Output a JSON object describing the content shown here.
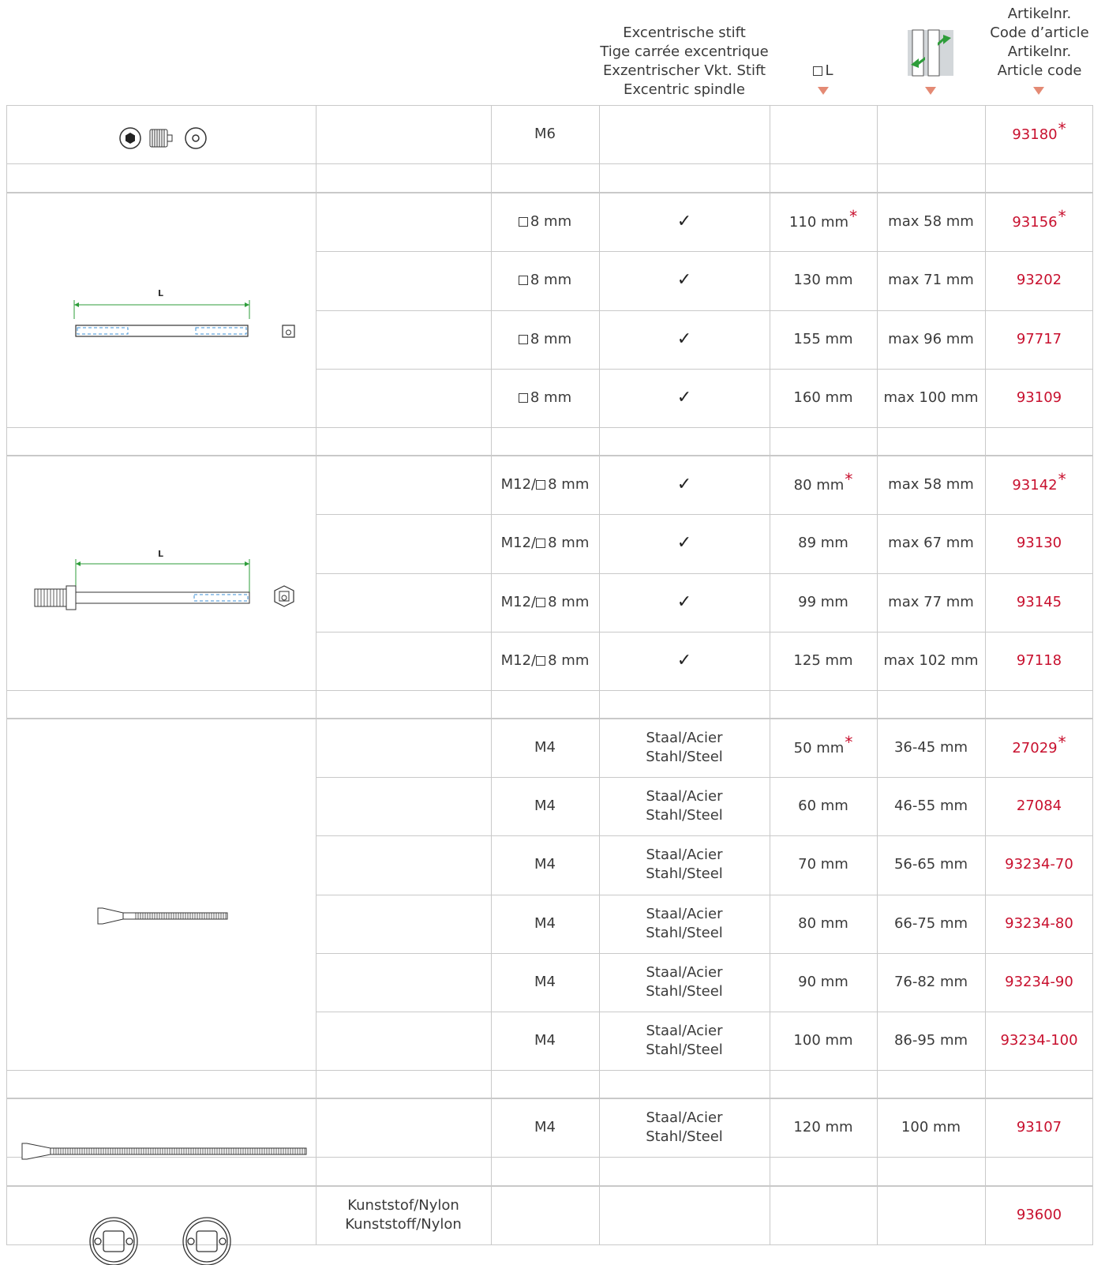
{
  "header": {
    "spindle_lines": [
      "Excentrische stift",
      "Tige carrée excentrique",
      "Exzentrischer Vkt. Stift",
      "Excentric spindle"
    ],
    "length_label": "L",
    "article_lines": [
      "Artikelnr.",
      "Code d’article",
      "Artikelnr.",
      "Article code"
    ],
    "door_thickness_icon": "door-thickness-icon",
    "accent_color": "#c8102e",
    "arrow_color": "#e48a74"
  },
  "groups": [
    {
      "image": "set-screw-icons",
      "rows": [
        {
          "material": "",
          "size": "M6",
          "spindle": "",
          "length": "",
          "length_star": false,
          "thickness": "",
          "code": "93180",
          "code_star": true
        }
      ]
    },
    {
      "image": "square-spindle-drawing",
      "image_label": "L",
      "rows": [
        {
          "material": "",
          "size": "8 mm",
          "size_prefix": "",
          "size_square": true,
          "spindle": "✓",
          "length": "110 mm",
          "length_star": true,
          "thickness": "max 58 mm",
          "code": "93156",
          "code_star": true
        },
        {
          "material": "",
          "size": "8 mm",
          "size_prefix": "",
          "size_square": true,
          "spindle": "✓",
          "length": "130 mm",
          "length_star": false,
          "thickness": "max 71 mm",
          "code": "93202",
          "code_star": false
        },
        {
          "material": "",
          "size": "8 mm",
          "size_prefix": "",
          "size_square": true,
          "spindle": "✓",
          "length": "155 mm",
          "length_star": false,
          "thickness": "max 96 mm",
          "code": "97717",
          "code_star": false
        },
        {
          "material": "",
          "size": "8 mm",
          "size_prefix": "",
          "size_square": true,
          "spindle": "✓",
          "length": "160 mm",
          "length_star": false,
          "thickness": "max 100 mm",
          "code": "93109",
          "code_star": false
        }
      ]
    },
    {
      "image": "threaded-spindle-drawing",
      "image_label": "L",
      "rows": [
        {
          "material": "",
          "size": "8 mm",
          "size_prefix": "M12/",
          "size_square": true,
          "spindle": "✓",
          "length": "80 mm",
          "length_star": true,
          "thickness": "max 58 mm",
          "code": "93142",
          "code_star": true
        },
        {
          "material": "",
          "size": "8 mm",
          "size_prefix": "M12/",
          "size_square": true,
          "spindle": "✓",
          "length": "89 mm",
          "length_star": false,
          "thickness": "max 67 mm",
          "code": "93130",
          "code_star": false
        },
        {
          "material": "",
          "size": "8 mm",
          "size_prefix": "M12/",
          "size_square": true,
          "spindle": "✓",
          "length": "99 mm",
          "length_star": false,
          "thickness": "max 77 mm",
          "code": "93145",
          "code_star": false
        },
        {
          "material": "",
          "size": "8 mm",
          "size_prefix": "M12/",
          "size_square": true,
          "spindle": "✓",
          "length": "125 mm",
          "length_star": false,
          "thickness": "max 102 mm",
          "code": "97118",
          "code_star": false
        }
      ]
    },
    {
      "image": "countersunk-screw-drawing",
      "rows": [
        {
          "material": "",
          "size": "M4",
          "spindle_lines": [
            "Staal/Acier",
            "Stahl/Steel"
          ],
          "length": "50 mm",
          "length_star": true,
          "thickness": "36-45 mm",
          "code": "27029",
          "code_star": true
        },
        {
          "material": "",
          "size": "M4",
          "spindle_lines": [
            "Staal/Acier",
            "Stahl/Steel"
          ],
          "length": "60 mm",
          "length_star": false,
          "thickness": "46-55 mm",
          "code": "27084",
          "code_star": false
        },
        {
          "material": "",
          "size": "M4",
          "spindle_lines": [
            "Staal/Acier",
            "Stahl/Steel"
          ],
          "length": "70 mm",
          "length_star": false,
          "thickness": "56-65 mm",
          "code": "93234-70",
          "code_star": false
        },
        {
          "material": "",
          "size": "M4",
          "spindle_lines": [
            "Staal/Acier",
            "Stahl/Steel"
          ],
          "length": "80 mm",
          "length_star": false,
          "thickness": "66-75 mm",
          "code": "93234-80",
          "code_star": false
        },
        {
          "material": "",
          "size": "M4",
          "spindle_lines": [
            "Staal/Acier",
            "Stahl/Steel"
          ],
          "length": "90 mm",
          "length_star": false,
          "thickness": "76-82 mm",
          "code": "93234-90",
          "code_star": false
        },
        {
          "material": "",
          "size": "M4",
          "spindle_lines": [
            "Staal/Acier",
            "Stahl/Steel"
          ],
          "length": "100 mm",
          "length_star": false,
          "thickness": "86-95 mm",
          "code": "93234-100",
          "code_star": false
        }
      ]
    },
    {
      "image": "long-screw-drawing",
      "rows": [
        {
          "material": "",
          "size": "M4",
          "spindle_lines": [
            "Staal/Acier",
            "Stahl/Steel"
          ],
          "length": "120 mm",
          "length_star": false,
          "thickness": "100 mm",
          "code": "93107",
          "code_star": false
        }
      ]
    },
    {
      "image": "nylon-bushing-icons",
      "rows": [
        {
          "material_lines": [
            "Kunststof/Nylon",
            "Kunststoff/Nylon"
          ],
          "size": "",
          "spindle": "",
          "length": "",
          "length_star": false,
          "thickness": "",
          "code": "93600",
          "code_star": false
        }
      ]
    }
  ]
}
